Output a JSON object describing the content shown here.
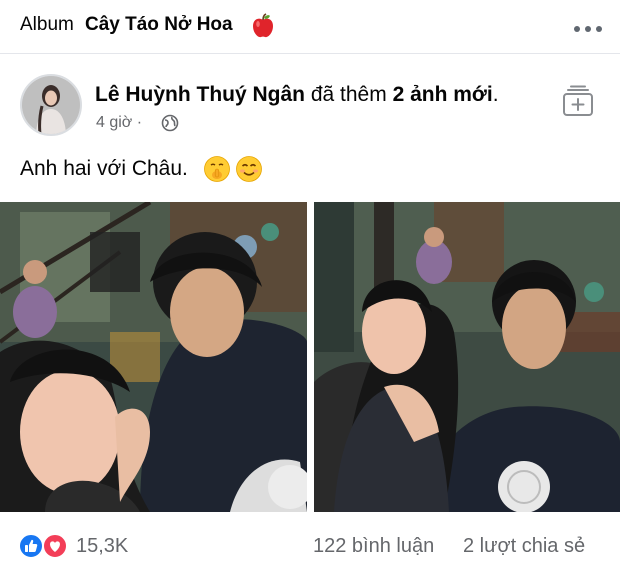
{
  "album": {
    "label": "Album",
    "name": "Cây Táo Nở Hoa",
    "icon": "apple-icon",
    "more_icon": "more-horizontal-icon"
  },
  "post": {
    "author": "Lê Huỳnh Thuý Ngân",
    "action": "đã thêm",
    "action_count": "2 ảnh mới",
    "time": "4 giờ",
    "separator": "·",
    "privacy_icon": "globe-icon",
    "save_icon": "save-to-collection-icon",
    "caption": "Anh hai với Châu.",
    "caption_emojis": [
      "shushing-face-icon",
      "smiling-face-icon"
    ]
  },
  "photos": [
    {
      "name": "photo-1"
    },
    {
      "name": "photo-2"
    }
  ],
  "footer": {
    "reactions_count": "15,3K",
    "comments": "122 bình luận",
    "shares": "2 lượt chia sẻ",
    "reaction_icons": [
      "like-icon",
      "love-icon"
    ]
  },
  "colors": {
    "like_blue": "#1877f2",
    "love_red": "#f33e58",
    "secondary_text": "#65676b"
  }
}
